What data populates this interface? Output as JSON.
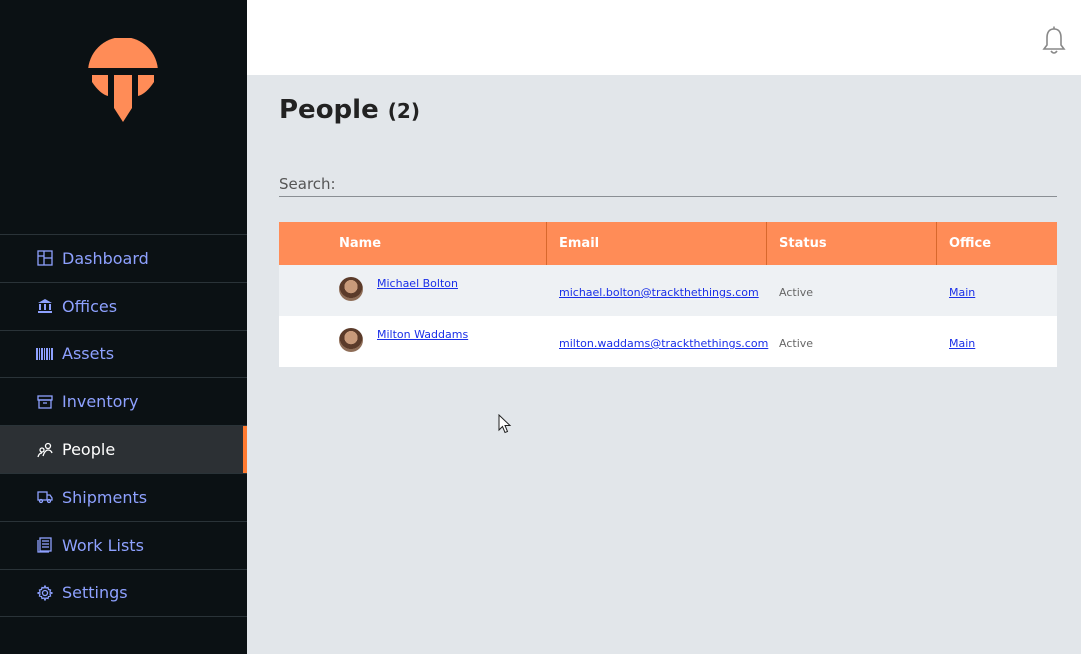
{
  "nav": {
    "items": [
      {
        "label": "Dashboard",
        "icon": "dashboard-icon",
        "active": false
      },
      {
        "label": "Offices",
        "icon": "bank-icon",
        "active": false
      },
      {
        "label": "Assets",
        "icon": "barcode-icon",
        "active": false
      },
      {
        "label": "Inventory",
        "icon": "archive-icon",
        "active": false
      },
      {
        "label": "People",
        "icon": "people-icon",
        "active": true
      },
      {
        "label": "Shipments",
        "icon": "truck-icon",
        "active": false
      },
      {
        "label": "Work Lists",
        "icon": "list-icon",
        "active": false
      },
      {
        "label": "Settings",
        "icon": "gear-icon",
        "active": false
      }
    ]
  },
  "header": {
    "bell_icon": "bell-icon"
  },
  "page": {
    "title": "People",
    "count": "(2)"
  },
  "search": {
    "label": "Search:",
    "value": ""
  },
  "table": {
    "columns": [
      "Name",
      "Email",
      "Status",
      "Office"
    ],
    "rows": [
      {
        "name": "Michael Bolton",
        "email": "michael.bolton@trackthethings.com",
        "status": "Active",
        "office": "Main"
      },
      {
        "name": "Milton Waddams",
        "email": "milton.waddams@trackthethings.com",
        "status": "Active",
        "office": "Main"
      }
    ]
  },
  "colors": {
    "accent": "#ff8c57",
    "sidebar_bg": "#0b1114",
    "nav_text": "#8ea1ff",
    "active_bar": "#ff7a30",
    "main_bg": "#e2e6ea"
  }
}
